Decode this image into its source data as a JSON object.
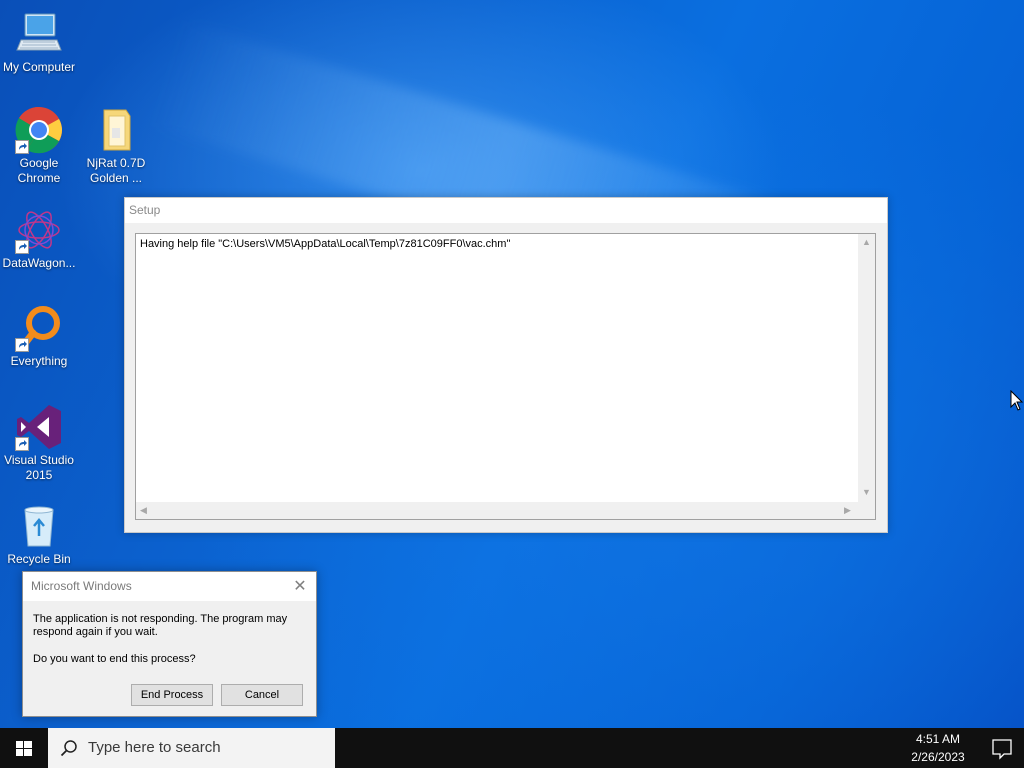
{
  "desktop": {
    "icons": [
      {
        "label": "My Computer",
        "icon": "computer-icon"
      },
      {
        "label": "Google Chrome",
        "icon": "chrome-icon"
      },
      {
        "label": "NjRat 0.7D Golden ...",
        "icon": "folder-icon"
      },
      {
        "label": "DataWagon...",
        "icon": "datawagon-icon"
      },
      {
        "label": "Everything",
        "icon": "everything-icon"
      },
      {
        "label": "Visual Studio 2015",
        "icon": "visual-studio-icon"
      },
      {
        "label": "Recycle Bin",
        "icon": "recycle-bin-icon"
      }
    ]
  },
  "setup_window": {
    "title": "Setup",
    "list_line": "Having help file \"C:\\Users\\VM5\\AppData\\Local\\Temp\\7z81C09FF0\\vac.chm\""
  },
  "dialog": {
    "title": "Microsoft Windows",
    "message": "The application is not responding. The program may respond again if you wait.",
    "question": "Do you want to end this process?",
    "end_button": "End Process",
    "cancel_button": "Cancel"
  },
  "taskbar": {
    "search_placeholder": "Type here to search",
    "time": "4:51 AM",
    "date": "2/26/2023"
  },
  "colors": {
    "accent": "#0a6fe0",
    "taskbar": "#101010"
  }
}
